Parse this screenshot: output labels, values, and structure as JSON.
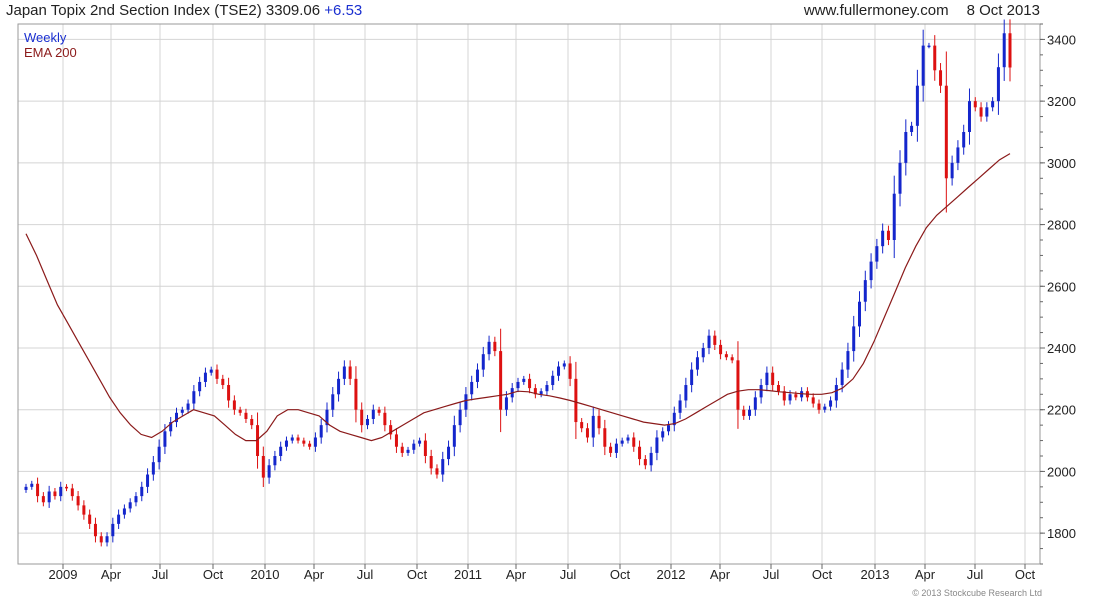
{
  "header": {
    "title": "Japan Topix 2nd Section Index (TSE2)",
    "last": "3309.06",
    "change": "+6.53",
    "site": "www.fullermoney.com",
    "date": "8 Oct 2013"
  },
  "copyright": "© 2013 Stockcube Research Ltd",
  "colors": {
    "up": "#1426cc",
    "down": "#dd1111",
    "ema": "#8b1a1a",
    "grid": "#d4d4d4",
    "weekly_label": "#1a2fd0"
  },
  "chart_data": {
    "type": "candlestick",
    "legend": [
      "Weekly",
      "EMA 200"
    ],
    "legend_position": "top-left",
    "grid": true,
    "ylim": [
      1700,
      3450
    ],
    "y_ticks": [
      1800,
      2000,
      2200,
      2400,
      2600,
      2800,
      3000,
      3200,
      3400
    ],
    "x_ticks": [
      "2009",
      "Apr",
      "Jul",
      "Oct",
      "2010",
      "Apr",
      "Jul",
      "Oct",
      "2011",
      "Apr",
      "Jul",
      "Oct",
      "2012",
      "Apr",
      "Jul",
      "Oct",
      "2013",
      "Apr",
      "Jul",
      "Oct"
    ],
    "weekly_close": [
      1950,
      1960,
      1920,
      1900,
      1935,
      1920,
      1950,
      1945,
      1920,
      1890,
      1860,
      1830,
      1790,
      1770,
      1790,
      1830,
      1860,
      1880,
      1900,
      1920,
      1950,
      1990,
      2030,
      2080,
      2130,
      2160,
      2190,
      2200,
      2220,
      2260,
      2290,
      2320,
      2330,
      2300,
      2280,
      2230,
      2200,
      2190,
      2170,
      2150,
      2050,
      1980,
      2020,
      2050,
      2080,
      2100,
      2110,
      2100,
      2090,
      2080,
      2110,
      2150,
      2200,
      2250,
      2300,
      2340,
      2300,
      2200,
      2150,
      2170,
      2200,
      2190,
      2150,
      2120,
      2080,
      2060,
      2070,
      2090,
      2100,
      2050,
      2010,
      1990,
      2040,
      2080,
      2150,
      2200,
      2250,
      2290,
      2330,
      2380,
      2420,
      2390,
      2200,
      2240,
      2270,
      2290,
      2300,
      2270,
      2250,
      2260,
      2280,
      2310,
      2340,
      2350,
      2300,
      2160,
      2140,
      2110,
      2180,
      2140,
      2080,
      2060,
      2090,
      2100,
      2110,
      2080,
      2040,
      2020,
      2060,
      2110,
      2130,
      2150,
      2190,
      2230,
      2280,
      2330,
      2370,
      2400,
      2440,
      2410,
      2380,
      2370,
      2360,
      2200,
      2180,
      2200,
      2240,
      2280,
      2320,
      2280,
      2260,
      2230,
      2250,
      2240,
      2260,
      2240,
      2220,
      2200,
      2210,
      2230,
      2280,
      2330,
      2390,
      2470,
      2550,
      2620,
      2680,
      2730,
      2780,
      2750,
      2900,
      3000,
      3100,
      3120,
      3250,
      3380,
      3380,
      3300,
      3250,
      2950,
      3000,
      3050,
      3100,
      3200,
      3180,
      3150,
      3180,
      3200,
      3310,
      3420,
      3309.06
    ],
    "ema200": [
      2770,
      2700,
      2620,
      2540,
      2480,
      2420,
      2360,
      2300,
      2240,
      2190,
      2150,
      2120,
      2110,
      2130,
      2160,
      2180,
      2200,
      2190,
      2180,
      2150,
      2120,
      2100,
      2100,
      2130,
      2180,
      2200,
      2200,
      2190,
      2180,
      2150,
      2130,
      2120,
      2110,
      2100,
      2110,
      2130,
      2150,
      2170,
      2190,
      2200,
      2210,
      2220,
      2230,
      2235,
      2240,
      2245,
      2250,
      2260,
      2258,
      2250,
      2245,
      2238,
      2230,
      2220,
      2210,
      2200,
      2190,
      2180,
      2170,
      2160,
      2155,
      2150,
      2155,
      2170,
      2190,
      2210,
      2230,
      2250,
      2260,
      2265,
      2265,
      2262,
      2258,
      2255,
      2252,
      2250,
      2250,
      2255,
      2270,
      2300,
      2350,
      2420,
      2500,
      2580,
      2660,
      2730,
      2790,
      2830,
      2860,
      2890,
      2920,
      2950,
      2980,
      3010,
      3030
    ],
    "ema_x_labels_note": ""
  }
}
